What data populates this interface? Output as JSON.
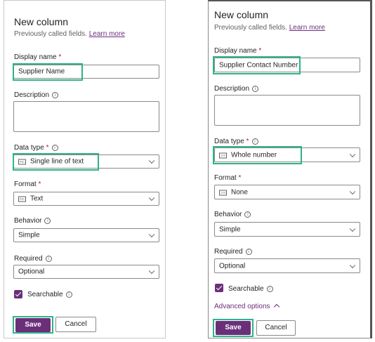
{
  "left": {
    "title": "New column",
    "subtitle": "Previously called fields.",
    "learn_more": "Learn more",
    "display_name_label": "Display name",
    "display_name_value": "Supplier Name",
    "description_label": "Description",
    "data_type_label": "Data type",
    "data_type_value": "Single line of text",
    "format_label": "Format",
    "format_value": "Text",
    "behavior_label": "Behavior",
    "behavior_value": "Simple",
    "required_label": "Required",
    "required_value": "Optional",
    "searchable_label": "Searchable",
    "save_label": "Save",
    "cancel_label": "Cancel"
  },
  "right": {
    "title": "New column",
    "subtitle": "Previously called fields.",
    "learn_more": "Learn more",
    "display_name_label": "Display name",
    "display_name_value": "Supplier Contact Number",
    "description_label": "Description",
    "data_type_label": "Data type",
    "data_type_value": "Whole number",
    "format_label": "Format",
    "format_value": "None",
    "behavior_label": "Behavior",
    "behavior_value": "Simple",
    "required_label": "Required",
    "required_value": "Optional",
    "searchable_label": "Searchable",
    "advanced_label": "Advanced options",
    "save_label": "Save",
    "cancel_label": "Cancel"
  },
  "required_marker": "*",
  "colors": {
    "accent": "#6b2f7a",
    "highlight": "#2db38a",
    "required": "#a4262c"
  },
  "icons": {
    "info": "info-icon",
    "field_type": "field-type-icon",
    "chevron": "chevron-down-icon"
  }
}
